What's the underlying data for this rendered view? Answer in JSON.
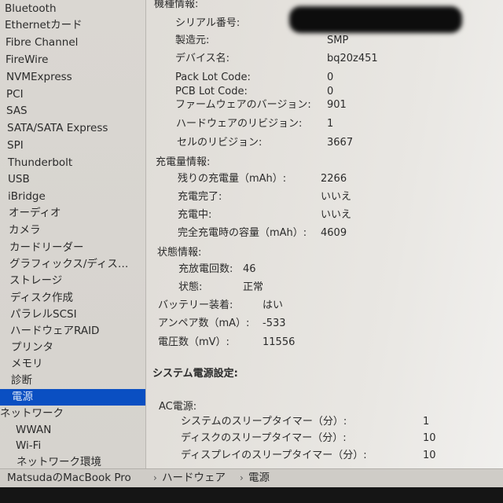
{
  "sidebar": {
    "items": [
      {
        "label": "Bluetooth"
      },
      {
        "label": "Ethernetカード"
      },
      {
        "label": "Fibre Channel"
      },
      {
        "label": "FireWire"
      },
      {
        "label": "NVMExpress"
      },
      {
        "label": "PCI"
      },
      {
        "label": "SAS"
      },
      {
        "label": "SATA/SATA Express"
      },
      {
        "label": "SPI"
      },
      {
        "label": "Thunderbolt"
      },
      {
        "label": "USB"
      },
      {
        "label": "iBridge"
      },
      {
        "label": "オーディオ"
      },
      {
        "label": "カメラ"
      },
      {
        "label": "カードリーダー"
      },
      {
        "label": "グラフィックス/ディス…"
      },
      {
        "label": "ストレージ"
      },
      {
        "label": "ディスク作成"
      },
      {
        "label": "パラレルSCSI"
      },
      {
        "label": "ハードウェアRAID"
      },
      {
        "label": "プリンタ"
      },
      {
        "label": "メモリ"
      },
      {
        "label": "診断"
      },
      {
        "label": "電源",
        "selected": true
      },
      {
        "label": "ネットワーク"
      },
      {
        "label": "WWAN"
      },
      {
        "label": "Wi-Fi"
      },
      {
        "label": "ネットワーク環境"
      }
    ],
    "selected_color": "#0a4fc2"
  },
  "content": {
    "model_info": {
      "heading": "機種情報:",
      "serial_label": "シリアル番号:",
      "serial_value": "[redacted]",
      "manufacturer_label": "製造元:",
      "manufacturer_value": "SMP",
      "device_name_label": "デバイス名:",
      "device_name_value": "bq20z451",
      "pack_lot_label": "Pack Lot Code:",
      "pack_lot_value": "0",
      "pcb_lot_label": "PCB Lot Code:",
      "pcb_lot_value": "0",
      "firmware_label": "ファームウェアのバージョン:",
      "firmware_value": "901",
      "hardware_rev_label": "ハードウェアのリビジョン:",
      "hardware_rev_value": "1",
      "cell_rev_label": "セルのリビジョン:",
      "cell_rev_value": "3667"
    },
    "charge_info": {
      "heading": "充電量情報:",
      "remaining_label": "残りの充電量（mAh）:",
      "remaining_value": "2266",
      "fully_charged_label": "充電完了:",
      "fully_charged_value": "いいえ",
      "charging_label": "充電中:",
      "charging_value": "いいえ",
      "full_capacity_label": "完全充電時の容量（mAh）:",
      "full_capacity_value": "4609"
    },
    "health_info": {
      "heading": "状態情報:",
      "cycle_count_label": "充放電回数:",
      "cycle_count_value": "46",
      "condition_label": "状態:",
      "condition_value": "正常"
    },
    "battery_installed_label": "バッテリー装着:",
    "battery_installed_value": "はい",
    "amperage_label": "アンペア数（mA）:",
    "amperage_value": "-533",
    "voltage_label": "電圧数（mV）:",
    "voltage_value": "11556",
    "power_settings": {
      "heading": "システム電源設定:",
      "ac_heading": "AC電源:",
      "system_sleep_label": "システムのスリープタイマー（分）:",
      "system_sleep_value": "1",
      "disk_sleep_label": "ディスクのスリープタイマー（分）:",
      "disk_sleep_value": "10",
      "display_sleep_label": "ディスプレイのスリープタイマー（分）:",
      "display_sleep_value": "10"
    }
  },
  "pathbar": {
    "computer": "MatsudaのMacBook Pro",
    "separator": "›",
    "category": "ハードウェア",
    "item": "電源"
  }
}
